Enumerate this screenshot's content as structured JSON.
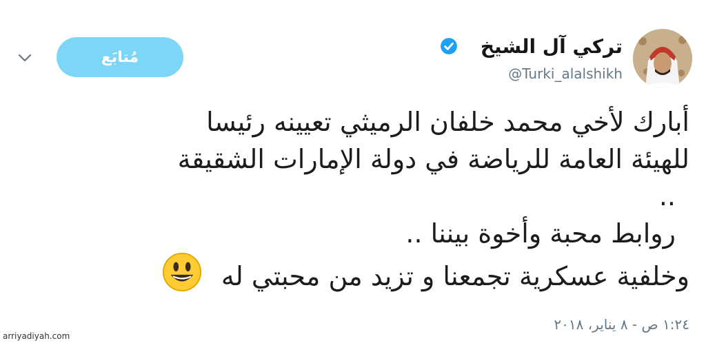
{
  "author": {
    "name": "تركي آل الشيخ",
    "handle": "@Turki_alalshikh",
    "verified": true
  },
  "actions": {
    "follow_label": "مُتابَع"
  },
  "tweet": {
    "lines": [
      "أبارك لأخي محمد خلفان الرميثي تعيينه رئيسا",
      "للهيئة العامة للرياضة في دولة الإمارات الشقيقة",
      "..",
      "روابط محبة وأخوة  بيننا ..",
      "وخلفية عسكرية تجمعنا و تزيد من محبتي له"
    ],
    "emoji": "grinning-face"
  },
  "timestamp": "١:٢٤ ص - ٨ يناير، ٢٠١٨",
  "watermark": "arriyadiyah.com",
  "colors": {
    "follow_button": "#7ed6f7",
    "verified_badge": "#1da1f2",
    "secondary_text": "#657786",
    "emoji_face": "#ffcc33"
  }
}
